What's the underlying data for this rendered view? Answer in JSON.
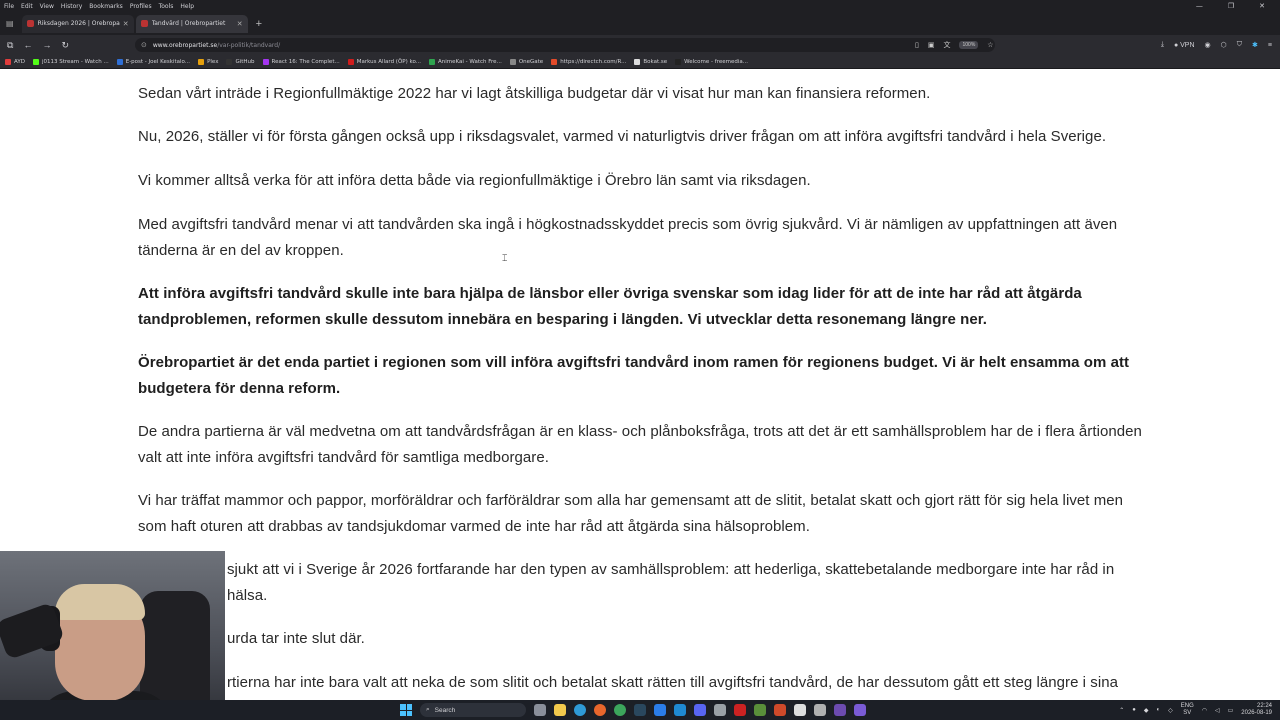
{
  "menubar": {
    "items": [
      "File",
      "Edit",
      "View",
      "History",
      "Bookmarks",
      "Profiles",
      "Tools",
      "Help"
    ]
  },
  "tabs": [
    {
      "title": "Riksdagen 2026 | Örebropartiet",
      "active": false
    },
    {
      "title": "Tandvård | Örebropartiet",
      "active": true
    }
  ],
  "address": {
    "domain": "www.orebropartiet.se",
    "path": "/var-politik/tandvard/",
    "zoom": "100%",
    "vpn_label": "VPN"
  },
  "bookmarks": [
    {
      "label": "AYD",
      "color": "#e03c3c"
    },
    {
      "label": "j0113 Stream - Watch ...",
      "color": "#53fc18"
    },
    {
      "label": "E-post - Joel Keskitalo...",
      "color": "#2f6fd6"
    },
    {
      "label": "Plex",
      "color": "#e5a00d"
    },
    {
      "label": "GitHub",
      "color": "#333333"
    },
    {
      "label": "React 16: The Complet...",
      "color": "#a435f0"
    },
    {
      "label": "Markus Allard (ÖP) ko...",
      "color": "#d01c1c"
    },
    {
      "label": "AnimeKai - Watch Fre...",
      "color": "#2fa44f"
    },
    {
      "label": "OneGate",
      "color": "#888888"
    },
    {
      "label": "https://directch.com/R...",
      "color": "#e34b2a"
    },
    {
      "label": "Bokat.se",
      "color": "#dddddd"
    },
    {
      "label": "Welcome - freemedia...",
      "color": "#222222"
    }
  ],
  "article": {
    "paragraphs": [
      {
        "text": "Sedan vårt inträde i Regionfullmäktige 2022 har vi lagt åtskilliga budgetar där vi visat hur man kan finansiera reformen.",
        "bold": false
      },
      {
        "text": "Nu, 2026, ställer vi för första gången också upp i riksdagsvalet, varmed vi naturligtvis driver frågan om att införa avgiftsfri tandvård i hela Sverige.",
        "bold": false
      },
      {
        "text": "Vi kommer alltså verka för att införa detta både via regionfullmäktige i Örebro län samt via riksdagen.",
        "bold": false
      },
      {
        "text": "Med avgiftsfri tandvård menar vi att tandvården ska ingå i högkostnadsskyddet precis som övrig sjukvård. Vi är nämligen av uppfattningen att även tänderna är en del av kroppen.",
        "bold": false
      },
      {
        "text": "Att införa avgiftsfri tandvård skulle inte bara hjälpa de länsbor eller övriga svenskar som idag lider för att de inte har råd att åtgärda tandproblemen, reformen skulle dessutom innebära en besparing i längden. Vi utvecklar detta resonemang längre ner.",
        "bold": true
      },
      {
        "text": "Örebropartiet är det enda partiet i regionen som vill införa avgiftsfri tandvård inom ramen för regionens budget. Vi är helt ensamma om att budgetera för denna reform.",
        "bold": true
      },
      {
        "text": "De andra partierna är väl medvetna om att tandvårdsfrågan är en klass- och plånboksfråga, trots att det är ett samhällsproblem har de i flera årtionden valt att inte införa avgiftsfri tandvård för samtliga medborgare.",
        "bold": false
      },
      {
        "text": "Vi har träffat mammor och pappor, morföräldrar och farföräldrar som alla har gemensamt att de slitit, betalat skatt och gjort rätt för sig hela livet men som haft oturen att drabbas av tandsjukdomar varmed de inte har råd att åtgärda sina hälsoproblem.",
        "bold": false
      },
      {
        "text": "sjukt att vi i Sverige år 2026 fortfarande har den typen av samhällsproblem: att hederliga, skattebetalande medborgare inte har råd in hälsa.",
        "bold": false
      },
      {
        "text": "urda tar inte slut där.",
        "bold": false
      },
      {
        "text": "rtierna har inte bara valt att neka de som slitit och betalat skatt rätten till avgiftsfri tandvård, de har dessutom gått ett steg längre i sina",
        "bold": false
      }
    ]
  },
  "taskbar": {
    "search_label": "Search",
    "lang_top": "ENG",
    "lang_bottom": "SV",
    "time": "22:24",
    "date": "2026-08-19"
  }
}
